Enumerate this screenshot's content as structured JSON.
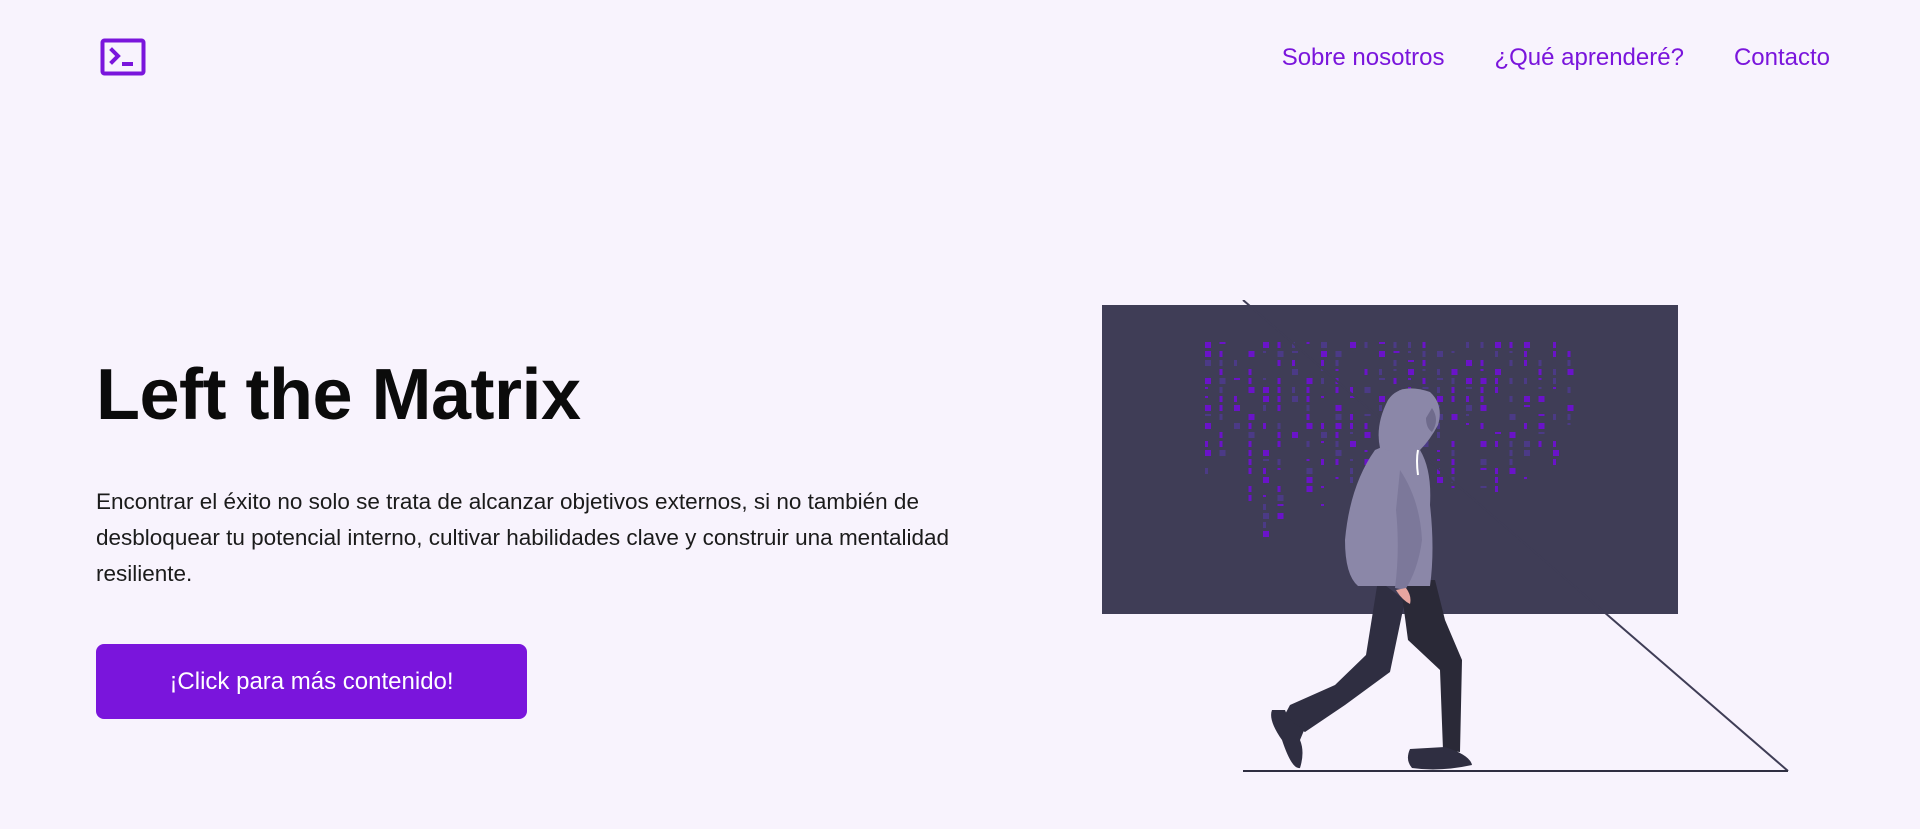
{
  "header": {
    "logo_icon": "terminal-icon",
    "nav": [
      {
        "label": "Sobre nosotros"
      },
      {
        "label": "¿Qué aprenderé?"
      },
      {
        "label": "Contacto"
      }
    ]
  },
  "hero": {
    "title": "Left the Matrix",
    "description": "Encontrar el éxito no solo se trata de alcanzar objetivos externos, si no también de desbloquear tu potencial interno, cultivar habilidades clave y construir una mentalidad resiliente.",
    "cta_label": "¡Click para más contenido!",
    "illustration_icon": "hooded-person-walking-matrix-illustration"
  },
  "colors": {
    "background": "#f8f3fd",
    "accent": "#7a15dc",
    "screen": "#3f3d56",
    "hoodie": "#8b87a8",
    "pants": "#2f2e41"
  }
}
